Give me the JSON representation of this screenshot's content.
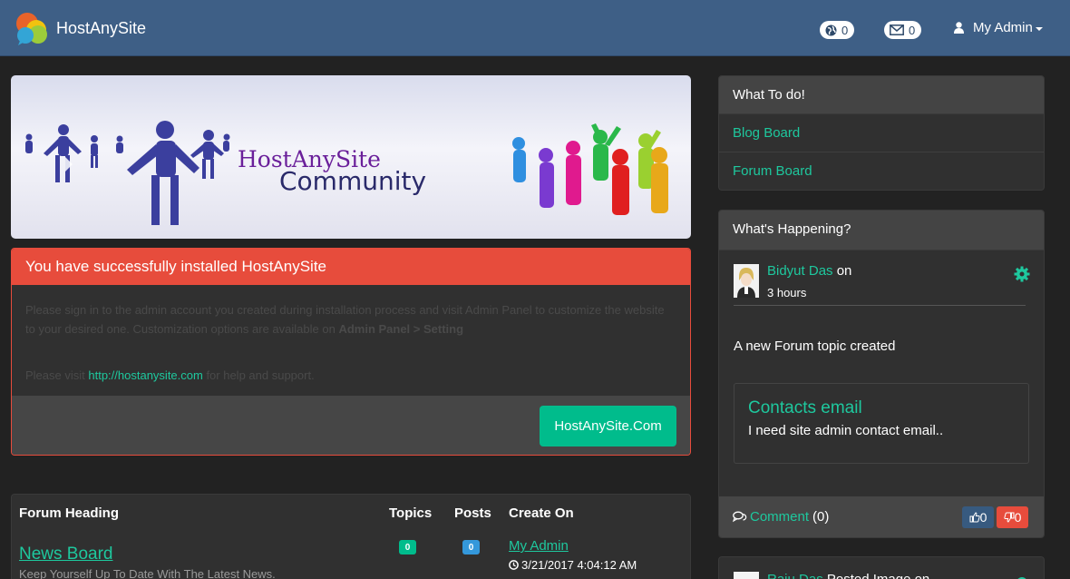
{
  "navbar": {
    "brand": "HostAnySite",
    "globe_count": "0",
    "mail_count": "0",
    "user_label": "My Admin"
  },
  "banner": {
    "title_line1": "HostAnySite",
    "title_line2": "Community"
  },
  "alert": {
    "heading": "You have successfully installed HostAnySite",
    "body_text": "Please sign in to the admin account you created during installation process and visit Admin Panel to customize the website to your desired one. Customization options are available on ",
    "body_bold": "Admin Panel > Setting",
    "visit_prefix": "Please visit ",
    "visit_link": "http://hostanysite.com",
    "visit_suffix": " for help and support.",
    "button_label": "HostAnySite.Com"
  },
  "forum": {
    "headers": {
      "heading": "Forum Heading",
      "topics": "Topics",
      "posts": "Posts",
      "created": "Create On"
    },
    "rows": [
      {
        "name": "News Board",
        "description": "Keep Yourself Up To Date With The Latest News.",
        "topics": "0",
        "posts": "0",
        "creator": "My Admin",
        "date": "3/21/2017 4:04:12 AM"
      }
    ]
  },
  "todo": {
    "heading": "What To do!",
    "items": [
      {
        "label": "Blog Board"
      },
      {
        "label": "Forum Board"
      }
    ]
  },
  "happening": {
    "heading": "What's Happening?",
    "user": "Bidyut Das",
    "user_suffix": " on",
    "time": "3 hours",
    "activity": "A new Forum topic created",
    "topic_title": "Contacts email",
    "topic_body": "I need site admin contact email..",
    "comment_label": "Comment",
    "comment_count": "(0)",
    "likes": "0",
    "dislikes": "0"
  },
  "next_activity": {
    "user": "Raju Das",
    "text": " Posted Image on"
  },
  "colors": {
    "navbar": "#3e5f86",
    "accent": "#00bc8c",
    "danger": "#e74c3c",
    "background": "#222222",
    "panel": "#303030"
  }
}
